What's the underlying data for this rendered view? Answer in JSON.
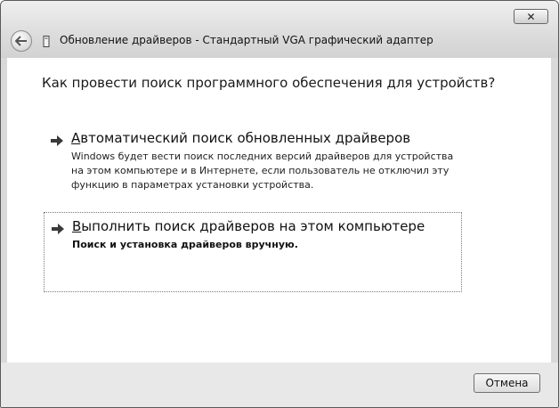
{
  "window": {
    "title": "Обновление драйверов - Стандартный VGA графический адаптер",
    "close_glyph": "✕"
  },
  "main": {
    "heading": "Как провести поиск программного обеспечения для устройств?",
    "options": [
      {
        "accelerator": "А",
        "title_rest": "втоматический поиск обновленных драйверов",
        "description": "Windows будет вести поиск последних версий драйверов для устройства на этом компьютере и в Интернете, если пользователь не отключил эту функцию в параметрах установки устройства.",
        "icon": "green-arrow-icon"
      },
      {
        "accelerator": "В",
        "title_rest": "ыполнить поиск драйверов на этом компьютере",
        "description": "Поиск и установка драйверов вручную.",
        "icon": "green-arrow-icon"
      }
    ]
  },
  "footer": {
    "cancel_label": "Отмена"
  },
  "colors": {
    "arrow": "#3a3a3a",
    "content_bg": "#ffffff",
    "frame_bg": "#d9d9d9"
  }
}
